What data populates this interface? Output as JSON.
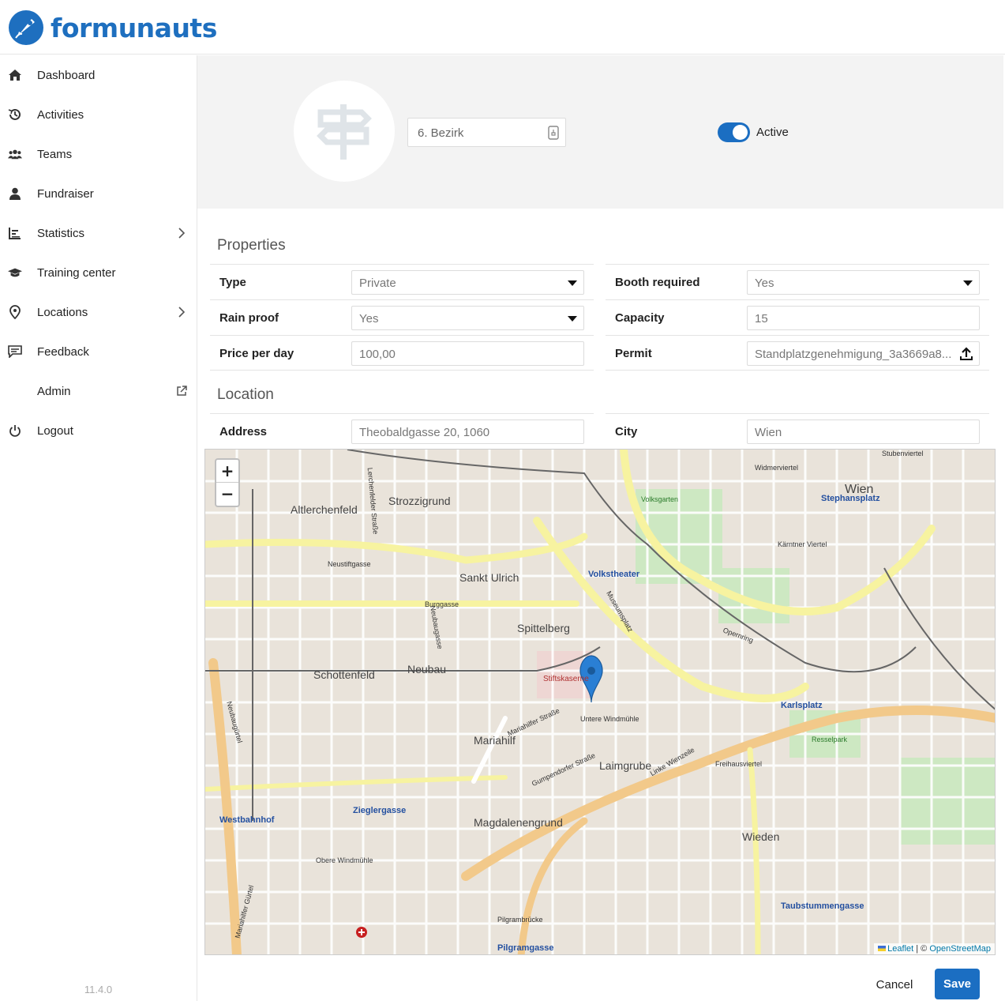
{
  "app": {
    "brand": "formunauts",
    "version": "11.4.0",
    "colors": {
      "accent": "#1b6ec2",
      "brand": "#1e6fbf"
    }
  },
  "sidebar": {
    "items": [
      {
        "label": "Dashboard",
        "icon": "home-icon",
        "chevron": false
      },
      {
        "label": "Activities",
        "icon": "history-icon",
        "chevron": false
      },
      {
        "label": "Teams",
        "icon": "users-icon",
        "chevron": false
      },
      {
        "label": "Fundraiser",
        "icon": "user-icon",
        "chevron": false
      },
      {
        "label": "Statistics",
        "icon": "chart-icon",
        "chevron": true
      },
      {
        "label": "Training center",
        "icon": "graduation-cap-icon",
        "chevron": false
      },
      {
        "label": "Locations",
        "icon": "map-pin-icon",
        "chevron": true
      },
      {
        "label": "Feedback",
        "icon": "comment-icon",
        "chevron": false
      },
      {
        "label": "Admin",
        "icon": "external-link-icon",
        "chevron": false
      },
      {
        "label": "Logout",
        "icon": "power-icon",
        "chevron": false
      }
    ]
  },
  "location": {
    "name": "6. Bezirk",
    "active_label": "Active",
    "active": true
  },
  "properties": {
    "title": "Properties",
    "type_label": "Type",
    "type_value": "Private",
    "booth_label": "Booth required",
    "booth_value": "Yes",
    "rain_label": "Rain proof",
    "rain_value": "Yes",
    "capacity_label": "Capacity",
    "capacity_value": "15",
    "price_label": "Price per day",
    "price_value": "100,00",
    "permit_label": "Permit",
    "permit_value": "Standplatzgenehmigung_3a3669a8..."
  },
  "location_section": {
    "title": "Location",
    "address_label": "Address",
    "address_value": "Theobaldgasse 20, 1060",
    "city_label": "City",
    "city_value": "Wien"
  },
  "map": {
    "zoom_in": "+",
    "zoom_out": "−",
    "attribution_leaflet": "Leaflet",
    "attribution_sep": " | © ",
    "attribution_osm": "OpenStreetMap",
    "labels": [
      "Altlerchenfeld",
      "Strozzigrund",
      "Sankt Ulrich",
      "Spittelberg",
      "Schottenfeld",
      "Neubau",
      "Mariahilf",
      "Laimgrube",
      "Magdalenengrund",
      "Wieden",
      "Wien",
      "Neustiftgasse",
      "Burggasse",
      "Volkstheater",
      "Karlsplatz",
      "Stephansplatz",
      "Zieglergasse",
      "Westbahnhof",
      "Pilgramgasse",
      "Taubstummengasse",
      "Stiftskaserne",
      "Untere Windmühle",
      "Obere Windmühle",
      "Freihausviertel",
      "Kärntner Viertel",
      "Museumsplatz",
      "Linke Wienzeile",
      "Opernring",
      "Pilgrambrücke",
      "Resselpark",
      "Widmerviertel",
      "Stubenviertel",
      "Volksgarten",
      "Mariahilfer Straße",
      "Gumpendorfer Straße",
      "Neubaugasse",
      "Lerchenfelder Straße",
      "Neubaugürtel",
      "Mariahilfer Gürtel"
    ]
  },
  "actions": {
    "cancel": "Cancel",
    "save": "Save"
  }
}
